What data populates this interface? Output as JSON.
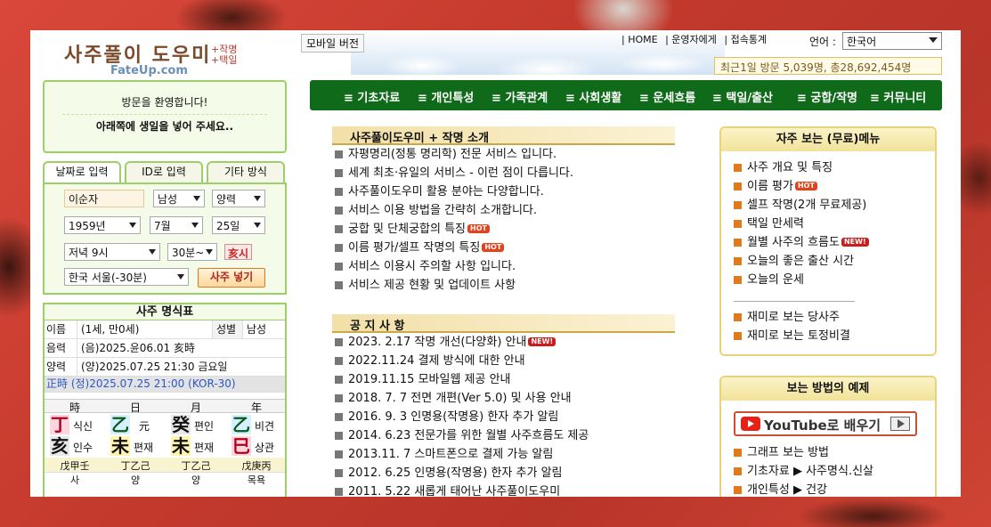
{
  "header": {
    "logo_main": "사주풀이 도우미",
    "logo_sub1": "+작명",
    "logo_sub2": "+택일",
    "logo_url": "FateUp.com",
    "mobile_label": "모바일 버전",
    "links": [
      "| HOME",
      "| 운영자에게",
      "| 접속통계"
    ],
    "lang_label": "언어 :",
    "lang_value": "한국어",
    "visitors": "최근1일 방문 5,039명, 총28,692,454명"
  },
  "welcome": {
    "line1": "방문을 환영합니다!",
    "line2": "아래쪽에 생일을 넣어 주세요.."
  },
  "input_tabs": [
    "날짜로 입력",
    "ID로 입력",
    "기타 방식"
  ],
  "form": {
    "name": "이순자",
    "gender": "남성",
    "calendar": "양력",
    "year": "1959년",
    "month": "7월",
    "day": "25일",
    "hour": "저녁 9시",
    "minute": "30분~",
    "hour_branch": "亥시",
    "location": "한국 서울(-30분)",
    "submit": "사주 넣기"
  },
  "myeong": {
    "title": "사주 명식표",
    "name_key": "이름",
    "name_val": "(1세, 만0세)",
    "sex_key": "성별",
    "sex_val": "남성",
    "lunar_key": "음력",
    "lunar_val": "(음)2025.윤06.01 亥時",
    "solar_key": "양력",
    "solar_val": "(양)2025.07.25 21:30 금요일",
    "true_time": "正時 (정)2025.07.25 21:00 (KOR-30)",
    "pillar_heads": [
      "時",
      "日",
      "月",
      "年"
    ],
    "stems": [
      "丁",
      "乙",
      "癸",
      "乙"
    ],
    "stem_notes": [
      "식신",
      "元",
      "편인",
      "비견"
    ],
    "branches": [
      "亥",
      "未",
      "未",
      "巳"
    ],
    "branch_notes": [
      "인수",
      "편재",
      "편재",
      "상관"
    ],
    "hidden": [
      "戊甲壬",
      "丁乙己",
      "丁乙己",
      "戊庚丙"
    ],
    "stages": [
      "사",
      "양",
      "양",
      "목욕"
    ],
    "colors": {
      "fire": "#ffd6e0",
      "wood": "#d6f0ff",
      "water": "#e8e8e8",
      "earth": "#fff4b0",
      "metal": "#f0f0f0"
    }
  },
  "menu": [
    "≡ 기초자료",
    "≡ 개인특성",
    "≡ 가족관계",
    "≡ 사회생활",
    "≡ 운세흐름",
    "≡ 택일/출산",
    "≡ 궁합/작명",
    "≡ 커뮤니티"
  ],
  "intro": {
    "title": "사주풀이도우미 + 작명 소개",
    "items": [
      {
        "text": "자평명리(정통 명리학) 전문 서비스 입니다.",
        "badge": ""
      },
      {
        "text": "세계 최초·유일의 서비스 - 이런 점이 다릅니다.",
        "badge": ""
      },
      {
        "text": "사주풀이도우미 활용 분야는 다양합니다.",
        "badge": ""
      },
      {
        "text": "서비스 이용 방법을 간략히 소개합니다.",
        "badge": ""
      },
      {
        "text": "궁합 및 단체궁합의 특징",
        "badge": "HOT"
      },
      {
        "text": "이름 평가/셀프 작명의 특징",
        "badge": "HOT"
      },
      {
        "text": "서비스 이용시 주의할 사항 입니다.",
        "badge": ""
      },
      {
        "text": "서비스 제공 현황 및 업데이트 사항",
        "badge": ""
      }
    ]
  },
  "notice": {
    "title": "공 지 사 항",
    "items": [
      {
        "text": "2023. 2.17 작명 개선(다양화) 안내",
        "badge": "NEW!"
      },
      {
        "text": "2022.11.24 결제 방식에 대한 안내",
        "badge": ""
      },
      {
        "text": "2019.11.15 모바일웹 제공 안내",
        "badge": ""
      },
      {
        "text": "2018. 7. 7 전면 개편(Ver 5.0) 및 사용 안내",
        "badge": ""
      },
      {
        "text": "2016. 9. 3 인명용(작명용) 한자 추가 알림",
        "badge": ""
      },
      {
        "text": "2014. 6.23 전문가를 위한 월별 사주흐름도 제공",
        "badge": ""
      },
      {
        "text": "2013.11. 7 스마트폰으로 결제 가능 알림",
        "badge": ""
      },
      {
        "text": "2012. 6.25 인명용(작명용) 한자 추가 알림",
        "badge": ""
      },
      {
        "text": "2011. 5.22 새롭게 태어난 사주풀이도우미",
        "badge": ""
      }
    ]
  },
  "free_menu": {
    "title": "자주 보는 (무료)메뉴",
    "items": [
      {
        "text": "사주 개요 및 특징",
        "badge": ""
      },
      {
        "text": "이름 평가",
        "badge": "HOT"
      },
      {
        "text": "셀프 작명(2개 무료제공)",
        "badge": ""
      },
      {
        "text": "택일 만세력",
        "badge": ""
      },
      {
        "text": "월별 사주의 흐름도",
        "badge": "NEW!"
      },
      {
        "text": "오늘의 좋은 출산 시간",
        "badge": ""
      },
      {
        "text": "오늘의 운세",
        "badge": ""
      }
    ],
    "fun_items": [
      {
        "text": "재미로 보는 당사주",
        "badge": ""
      },
      {
        "text": "재미로 보는 토정비결",
        "badge": ""
      }
    ]
  },
  "examples": {
    "title": "보는 방법의 예제",
    "youtube_label": "YouTube로 배우기",
    "items": [
      {
        "text": "그래프 보는 방법",
        "badge": ""
      },
      {
        "text": "기초자료 ▶ 사주명식.신살",
        "badge": ""
      },
      {
        "text": "개인특성 ▶ 건강",
        "badge": ""
      }
    ]
  }
}
